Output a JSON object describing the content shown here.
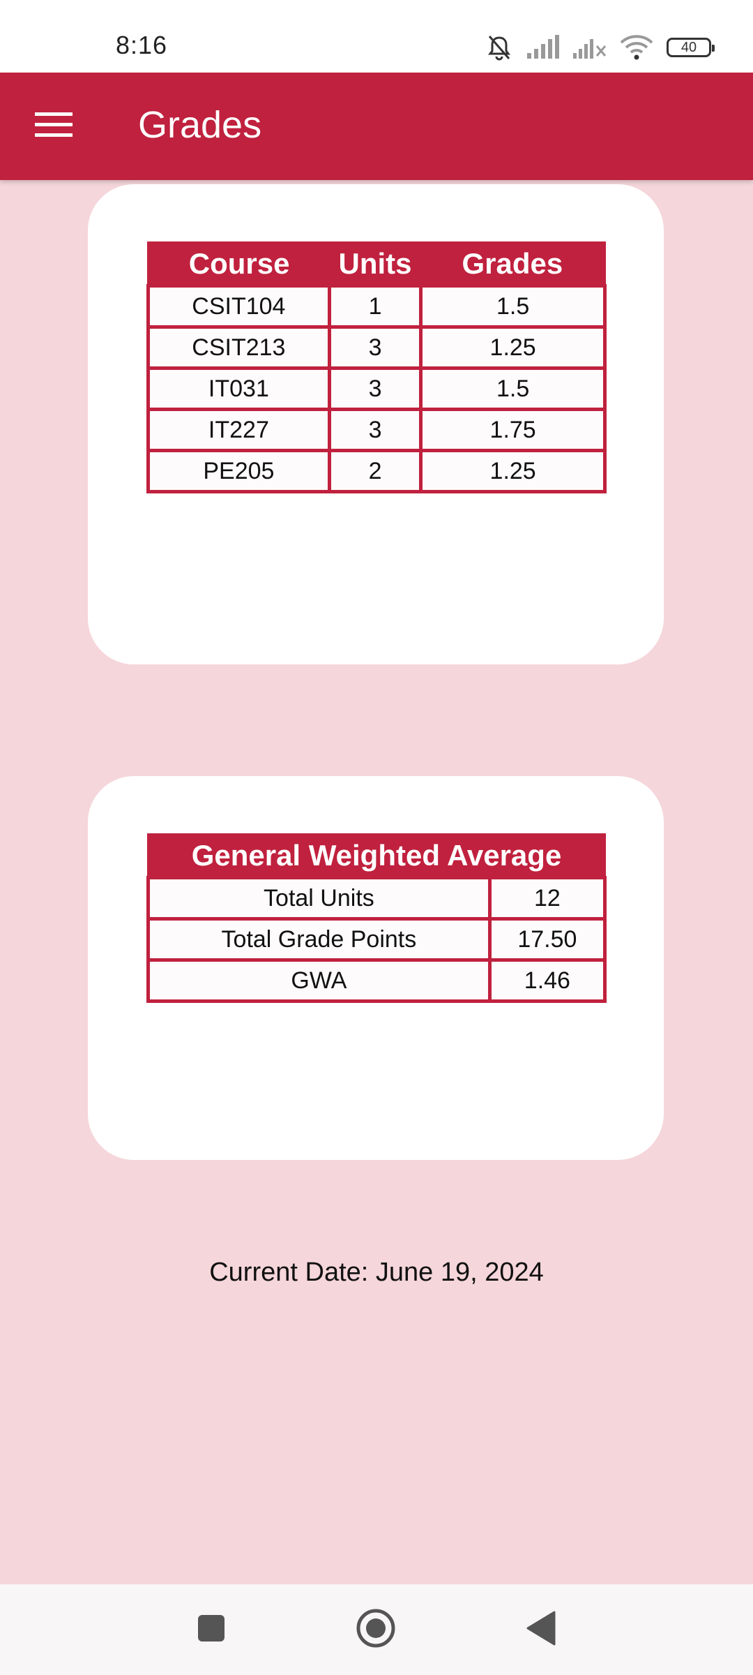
{
  "status_bar": {
    "time": "8:16",
    "battery_level": "40",
    "icons": [
      "bell-muted-icon",
      "signal-icon",
      "signal-off-icon",
      "wifi-icon",
      "battery-icon"
    ]
  },
  "app_bar": {
    "title": "Grades",
    "menu_icon": "hamburger-menu-icon",
    "color": "#c0213e"
  },
  "grades_table": {
    "headers": [
      "Course",
      "Units",
      "Grades"
    ],
    "rows": [
      [
        "CSIT104",
        "1",
        "1.5"
      ],
      [
        "CSIT213",
        "3",
        "1.25"
      ],
      [
        "IT031",
        "3",
        "1.5"
      ],
      [
        "IT227",
        "3",
        "1.75"
      ],
      [
        "PE205",
        "2",
        "1.25"
      ]
    ]
  },
  "gwa_table": {
    "header": "General Weighted Average",
    "rows": [
      [
        "Total Units",
        "12"
      ],
      [
        "Total Grade Points",
        "17.50"
      ],
      [
        "GWA",
        "1.46"
      ]
    ]
  },
  "current_date": "Current Date: June 19, 2024",
  "nav_bar": {
    "icons": [
      "recents-square-icon",
      "home-circle-icon",
      "back-triangle-icon"
    ]
  },
  "colors": {
    "accent": "#c0213e",
    "background": "#f5d6db",
    "card": "#ffffff"
  }
}
